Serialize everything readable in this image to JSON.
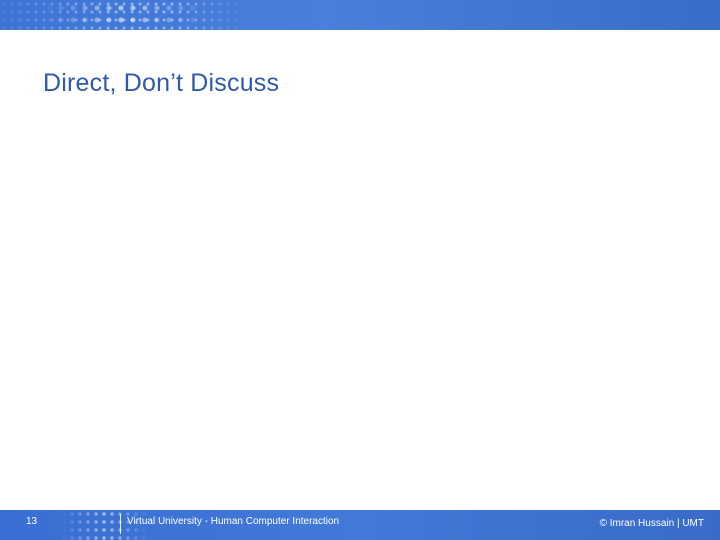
{
  "slide": {
    "title": "Direct, Don’t Discuss",
    "page_number": "13",
    "footer_course": "Virtual University - Human Computer Interaction",
    "footer_copyright": "© Imran Hussain | UMT"
  },
  "colors": {
    "banner_blue": "#4a7fdc",
    "title_blue": "#2f5aa8",
    "background": "#ffffff"
  }
}
